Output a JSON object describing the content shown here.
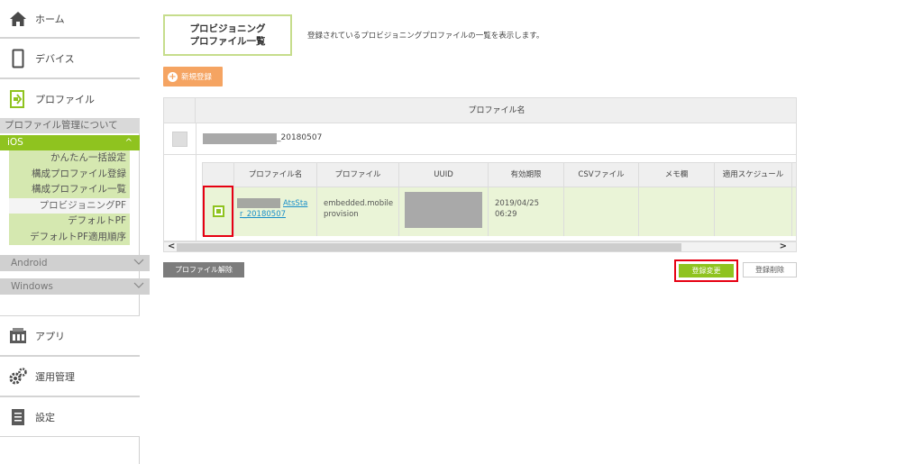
{
  "sidebar": {
    "home": "ホーム",
    "device": "デバイス",
    "profile": "プロファイル",
    "profile_about": "プロファイル管理について",
    "ios": {
      "label": "iOS",
      "items": [
        "かんたん一括設定",
        "構成プロファイル登録",
        "構成プロファイル一覧",
        "プロビジョニングPF",
        "デフォルトPF",
        "デフォルトPF適用順序"
      ],
      "active_index": 3
    },
    "android": "Android",
    "windows": "Windows",
    "app": "アプリ",
    "ops": "運用管理",
    "settings": "設定"
  },
  "header": {
    "title_line1": "プロビジョニング",
    "title_line2": "プロファイル一覧",
    "description": "登録されているプロビジョニングプロファイルの一覧を表示します。",
    "new_button": "新規登録"
  },
  "table": {
    "header": "プロファイル名",
    "row_name_suffix": "_20180507",
    "inner_columns": [
      "プロファイル名",
      "プロファイル",
      "UUID",
      "有効期限",
      "CSVファイル",
      "メモ欄",
      "適用スケジュール"
    ],
    "inner_row": {
      "name_line1": "AtsSta",
      "name_line2": "r_20180507",
      "profile_file": "embedded.mobileprovision",
      "expiry_date": "2019/04/25",
      "expiry_time": "06:29"
    }
  },
  "scroll": {
    "left": "<",
    "right": ">"
  },
  "actions": {
    "release": "プロファイル解除",
    "change": "登録変更",
    "delete": "登録削除"
  },
  "colors": {
    "accent_green": "#8fc31f",
    "orange": "#f5a462",
    "highlight_red": "#e60012"
  }
}
